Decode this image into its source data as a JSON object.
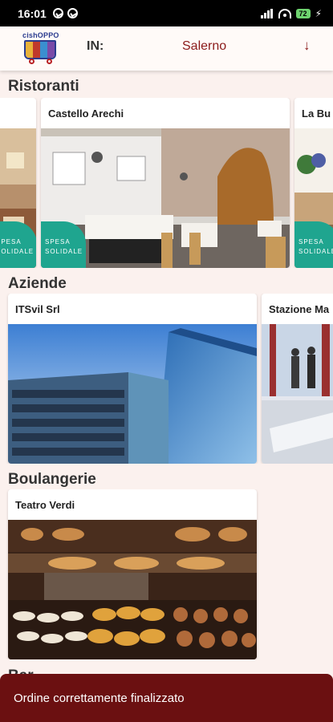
{
  "status_bar": {
    "time": "16:01",
    "battery": "72"
  },
  "header": {
    "logo_text": "cishOPPO",
    "in_label": "IN:",
    "city": "Salerno"
  },
  "sections": [
    {
      "title": "Ristoranti",
      "cards": [
        {
          "title": "",
          "badge": "SPESA SOLIDALE"
        },
        {
          "title": "Castello Arechi",
          "badge": "SPESA SOLIDALE"
        },
        {
          "title": "La Bu",
          "badge": "SPESA SOLIDALE"
        }
      ]
    },
    {
      "title": "Aziende",
      "cards": [
        {
          "title": "ITSvil Srl"
        },
        {
          "title": "Stazione Ma"
        }
      ]
    },
    {
      "title": "Boulangerie",
      "cards": [
        {
          "title": "Teatro Verdi"
        }
      ]
    },
    {
      "title": "Bar"
    }
  ],
  "snackbar": {
    "message": "Ordine correttamente finalizzato"
  },
  "colors": {
    "accent": "#8b1a1a",
    "badge": "#1fa58f",
    "snackbar": "#6b1011",
    "background": "#fbf1ee"
  }
}
